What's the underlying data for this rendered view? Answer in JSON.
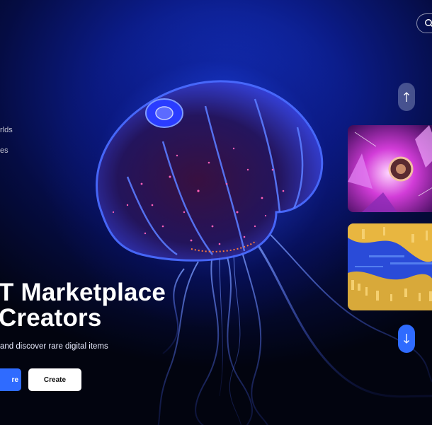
{
  "nav": {
    "items": [
      "rlds",
      "es"
    ]
  },
  "hero": {
    "line1": "T Marketplace",
    "line2": " Creators",
    "subtitle": "and discover rare digital items",
    "explore_label": "re",
    "create_label": "Create"
  },
  "icons": {
    "search": "search-icon",
    "up": "arrow-up-icon",
    "down": "arrow-down-icon"
  },
  "colors": {
    "accent": "#2f6bff",
    "background": "#02040f",
    "jelly_pink": "#ff4fb8",
    "jelly_blue": "#3a4dff"
  }
}
